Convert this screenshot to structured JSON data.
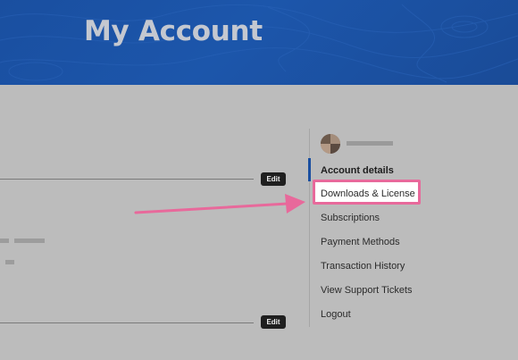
{
  "header": {
    "title": "My Account"
  },
  "main": {
    "edit_buttons": [
      "Edit",
      "Edit"
    ]
  },
  "sidebar": {
    "items": [
      {
        "label": "Account details",
        "active": true
      },
      {
        "label": "Downloads & License",
        "active": false
      },
      {
        "label": "Subscriptions",
        "active": false
      },
      {
        "label": "Payment Methods",
        "active": false
      },
      {
        "label": "Transaction History",
        "active": false
      },
      {
        "label": "View Support Tickets",
        "active": false
      },
      {
        "label": "Logout",
        "active": false
      }
    ]
  },
  "colors": {
    "header_blue": "#1a4fa0",
    "highlight_pink": "#e8699b",
    "background": "#bcbcbc"
  }
}
